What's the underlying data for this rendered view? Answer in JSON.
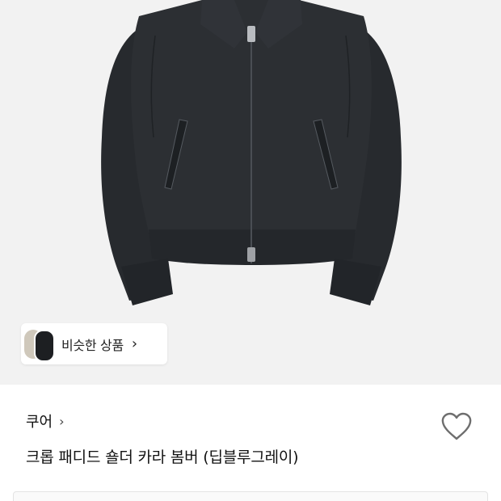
{
  "product": {
    "similar_label": "비슷한 상품",
    "similar_chevron": "›",
    "brand_name": "쿠어",
    "brand_chevron": "›",
    "title": "크롭 패디드 숄더 카라 봄버 (딥블루그레이)"
  },
  "icons": {
    "similar_thumb_1": "beige-garment-thumbnail",
    "similar_thumb_2": "black-garment-thumbnail",
    "wishlist": "heart-outline-icon"
  },
  "colors": {
    "hero_background": "#f2f2f2",
    "jacket": "#2a2d31",
    "text_primary": "#111111"
  }
}
